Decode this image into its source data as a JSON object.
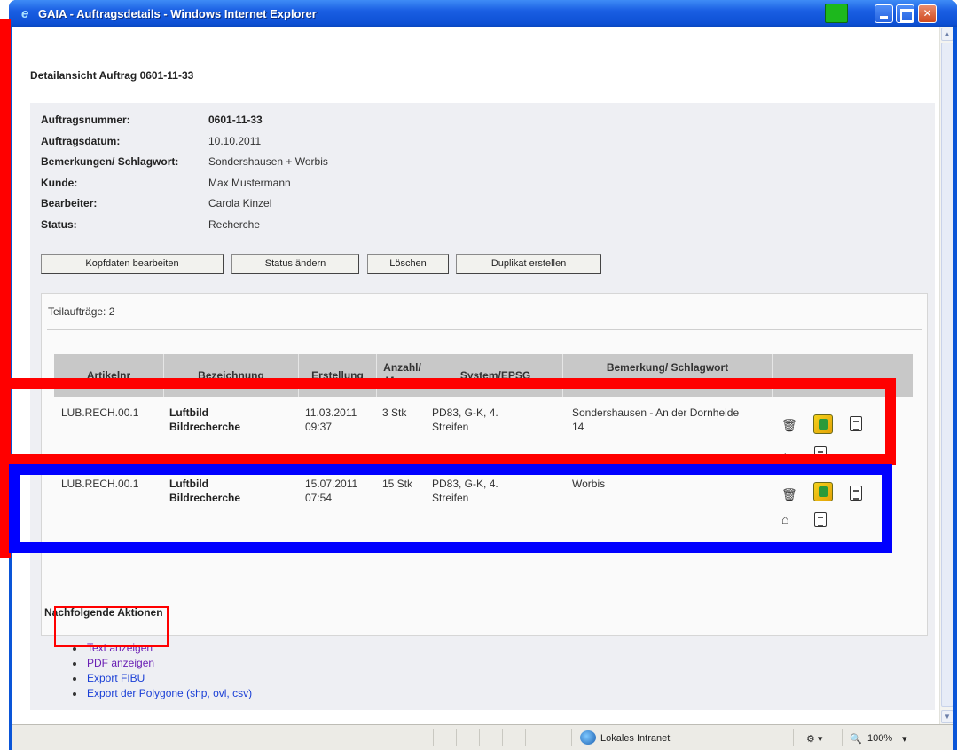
{
  "window": {
    "title": "GAIA - Auftragsdetails - Windows Internet Explorer"
  },
  "page": {
    "title": "Detailansicht Auftrag 0601-11-33"
  },
  "fields": [
    {
      "label": "Auftragsnummer:",
      "value": "0601-11-33"
    },
    {
      "label": "Auftragsdatum:",
      "value": "10.10.2011"
    },
    {
      "label": "Bemerkungen/ Schlagwort:",
      "value": "Sondershausen + Worbis"
    },
    {
      "label": "Kunde:",
      "value": "Max Mustermann"
    },
    {
      "label": "Bearbeiter:",
      "value": "Carola Kinzel"
    },
    {
      "label": "Status:",
      "value": "Recherche"
    }
  ],
  "buttons": {
    "edit_header": "Kopfdaten bearbeiten",
    "change_status": "Status ändern",
    "delete": "Löschen",
    "duplicate": "Duplikat erstellen"
  },
  "subjobs": {
    "count_label": "Teilaufträge: 2",
    "columns": [
      "Artikelnr",
      "Bezeichnung",
      "Erstellung",
      "Anzahl/ Menge",
      "System/EPSG",
      "Bemerkung/ Schlagwort",
      ""
    ],
    "rows": [
      {
        "artikelnr": "LUB.RECH.00.1",
        "bezeichnung": "Luftbild Bildrecherche",
        "erstellung_date": "11.03.2011",
        "erstellung_time": "09:37",
        "menge": "3 Stk",
        "system": "PD83, G-K, 4. Streifen",
        "bemerkung": "Sondershausen - An der Dornheide 14"
      },
      {
        "artikelnr": "LUB.RECH.00.1",
        "bezeichnung": "Luftbild Bildrecherche",
        "erstellung_date": "15.07.2011",
        "erstellung_time": "07:54",
        "menge": "15 Stk",
        "system": "PD83, G-K, 4. Streifen",
        "bemerkung": "Worbis"
      }
    ]
  },
  "actions": {
    "title": "Nachfolgende Aktionen",
    "items": [
      "Text anzeigen",
      "PDF anzeigen",
      "Export FIBU",
      "Export der Polygone (shp, ovl, csv)"
    ]
  },
  "statusbar": {
    "zone": "Lokales Intranet",
    "zoom": "100%"
  },
  "colors": {
    "highlight_red": "#ff0000",
    "highlight_blue": "#0000ff",
    "titlebar": "#0a55d8"
  }
}
